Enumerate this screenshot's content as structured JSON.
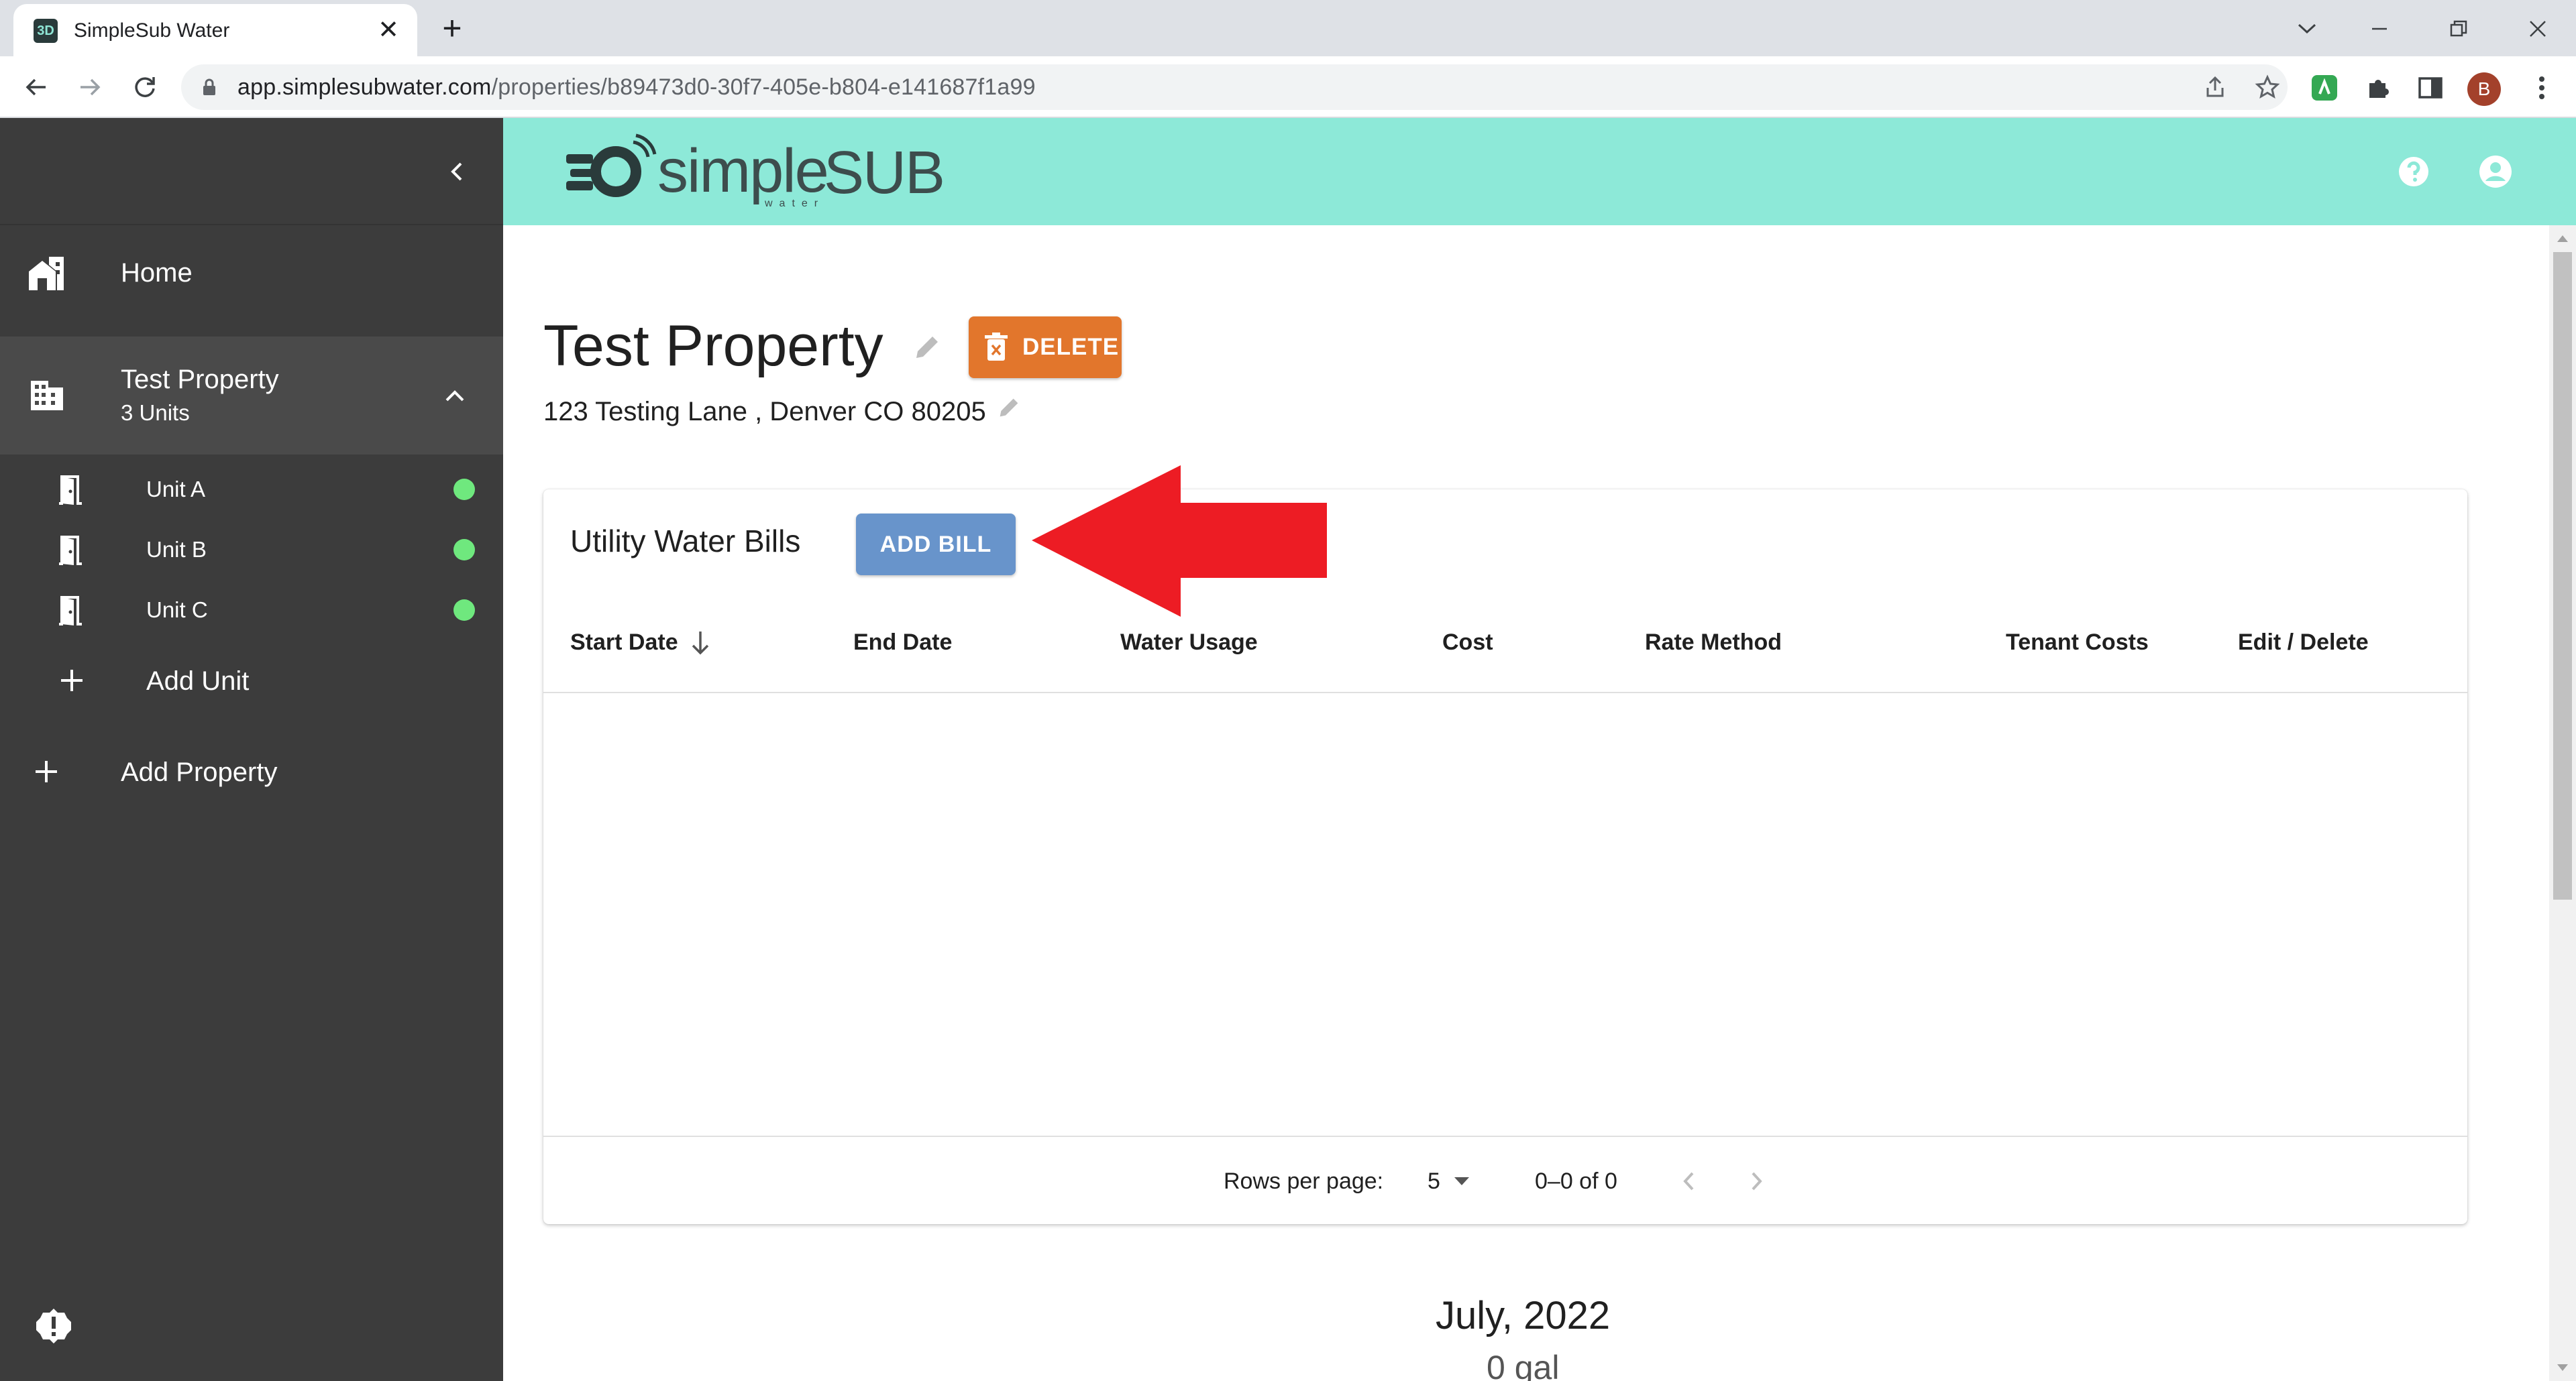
{
  "browser": {
    "tab_title": "SimpleSub Water",
    "favicon_text": "3D",
    "new_tab_symbol": "+",
    "close_symbol": "✕",
    "url_domain": "app.simplesubwater.com",
    "url_path": "/properties/b89473d0-30f7-405e-b804-e141687f1a99",
    "profile_initial": "B",
    "profile_color": "#a3412b"
  },
  "header": {
    "logo_alt": "simpleSUB water",
    "accent_color": "#8de9d8"
  },
  "sidebar": {
    "bg_color": "#3c3c3c",
    "home_label": "Home",
    "property": {
      "name": "Test Property",
      "units_count": "3 Units"
    },
    "units": [
      {
        "label": "Unit A",
        "status_color": "#6fe87e"
      },
      {
        "label": "Unit B",
        "status_color": "#6fe87e"
      },
      {
        "label": "Unit C",
        "status_color": "#6fe87e"
      }
    ],
    "add_unit_label": "Add Unit",
    "add_property_label": "Add Property"
  },
  "page": {
    "title": "Test Property",
    "delete_label": "DELETE",
    "delete_color": "#e2762c",
    "address": "123 Testing Lane , Denver CO 80205"
  },
  "bills": {
    "title": "Utility Water Bills",
    "add_bill_label": "ADD BILL",
    "add_bill_color": "#6894cb",
    "columns": [
      "Start Date",
      "End Date",
      "Water Usage",
      "Cost",
      "Rate Method",
      "Tenant Costs",
      "Edit / Delete"
    ],
    "rows": [],
    "rows_per_page_label": "Rows per page:",
    "rows_per_page_value": "5",
    "range_text": "0–0 of 0"
  },
  "annotation": {
    "arrow_color": "#ed1c24"
  },
  "usage_summary": {
    "month": "July, 2022",
    "amount": "0 gal"
  }
}
